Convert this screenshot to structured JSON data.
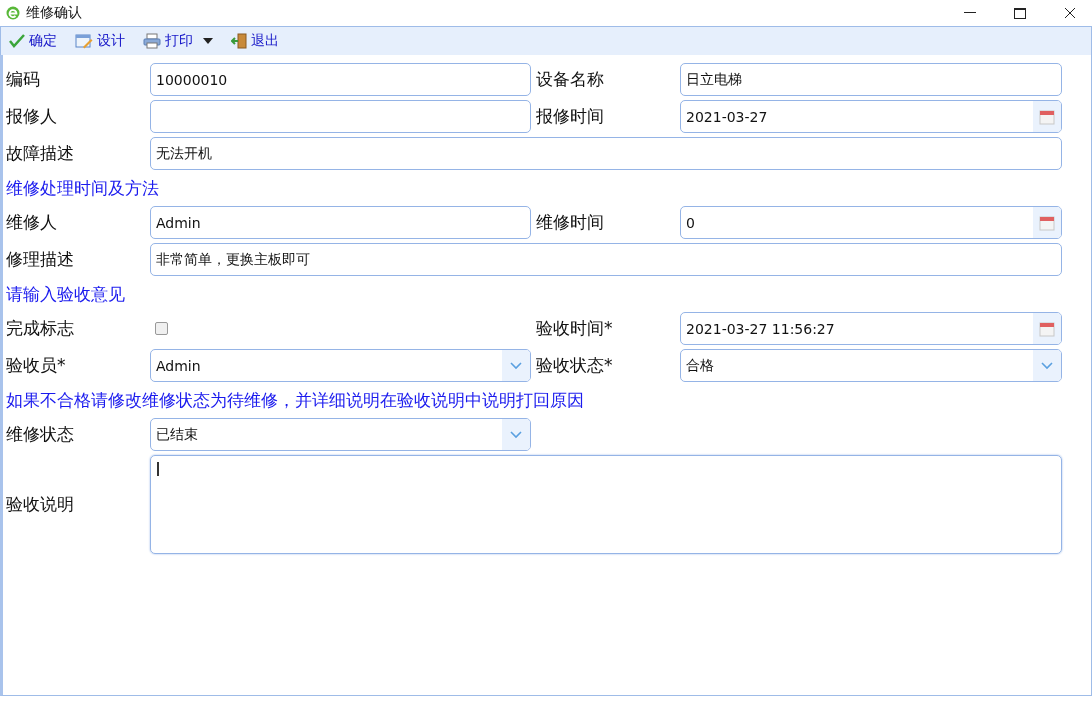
{
  "window": {
    "title": "维修确认"
  },
  "toolbar": [
    {
      "label": "确定",
      "kind": "check",
      "dropdown": false
    },
    {
      "label": "设计",
      "kind": "design",
      "dropdown": false
    },
    {
      "label": "打印",
      "kind": "print",
      "dropdown": true
    },
    {
      "label": "退出",
      "kind": "exit",
      "dropdown": false
    }
  ],
  "rows": [
    {
      "kind": "pair",
      "fields": [
        {
          "label": "编码",
          "kind": "text",
          "value": "10000010"
        },
        {
          "label": "设备名称",
          "kind": "text",
          "value": "日立电梯"
        }
      ]
    },
    {
      "kind": "pair",
      "fields": [
        {
          "label": "报修人",
          "kind": "text"
        },
        {
          "label": "报修时间",
          "kind": "date",
          "value": "2021-03-27"
        }
      ]
    },
    {
      "kind": "full",
      "fields": [
        {
          "label": "故障描述",
          "kind": "text",
          "value": "无法开机"
        }
      ]
    },
    {
      "kind": "section",
      "text": "维修处理时间及方法"
    },
    {
      "kind": "pair",
      "fields": [
        {
          "label": "维修人",
          "kind": "text",
          "value": "Admin"
        },
        {
          "label": "维修时间",
          "kind": "date",
          "value": "0"
        }
      ]
    },
    {
      "kind": "full",
      "fields": [
        {
          "label": "修理描述",
          "kind": "text",
          "value": "非常简单，更换主板即可"
        }
      ]
    },
    {
      "kind": "section",
      "text": "请输入验收意见"
    },
    {
      "kind": "pair",
      "fields": [
        {
          "label": "完成标志",
          "kind": "checkbox",
          "checked": false
        },
        {
          "label": "验收时间*",
          "kind": "date",
          "value": "2021-03-27 11:56:27"
        }
      ]
    },
    {
      "kind": "pair",
      "fields": [
        {
          "label": "验收员*",
          "kind": "select",
          "value": "Admin"
        },
        {
          "label": "验收状态*",
          "kind": "select",
          "value": "合格"
        }
      ]
    },
    {
      "kind": "section",
      "text": "如果不合格请修改维修状态为待维修，并详细说明在验收说明中说明打回原因"
    },
    {
      "kind": "pair",
      "fields": [
        {
          "label": "维修状态",
          "kind": "select",
          "value": "已结束"
        }
      ]
    },
    {
      "kind": "textarea",
      "fields": [
        {
          "label": "验收说明",
          "kind": "textarea"
        }
      ]
    }
  ]
}
